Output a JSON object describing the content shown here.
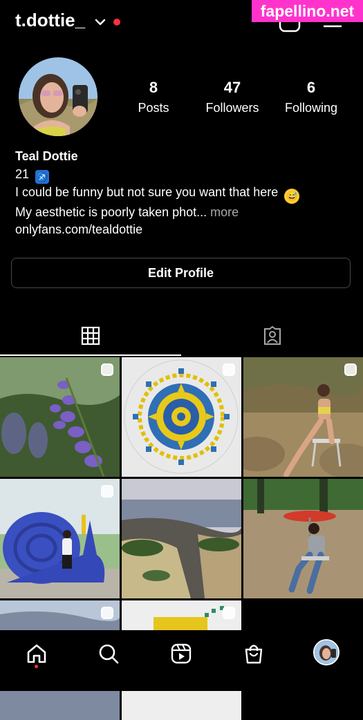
{
  "header": {
    "username": "t.dottie_",
    "watermark": "fapellino.net"
  },
  "profile": {
    "stats": [
      {
        "value": "8",
        "label": "Posts"
      },
      {
        "value": "47",
        "label": "Followers"
      },
      {
        "value": "6",
        "label": "Following"
      }
    ],
    "bio": {
      "name": "Teal Dottie",
      "age": "21",
      "age_badge": "♐",
      "line1": "I could be funny but not sure you want that here",
      "line1_emoji": "😅",
      "line2": "My aesthetic is poorly taken phot...",
      "more": "more",
      "link": "onlyfans.com/tealdottie"
    },
    "edit_button": "Edit Profile"
  },
  "tabs": [
    {
      "icon": "grid-icon",
      "active": true
    },
    {
      "icon": "tagged-icon",
      "active": false
    }
  ],
  "colors": {
    "accent": "#ff3040",
    "watermark": "#ff33cc",
    "background": "#000000"
  },
  "bottom_nav": [
    "home-icon",
    "search-icon",
    "reels-icon",
    "shop-icon",
    "profile-avatar"
  ]
}
